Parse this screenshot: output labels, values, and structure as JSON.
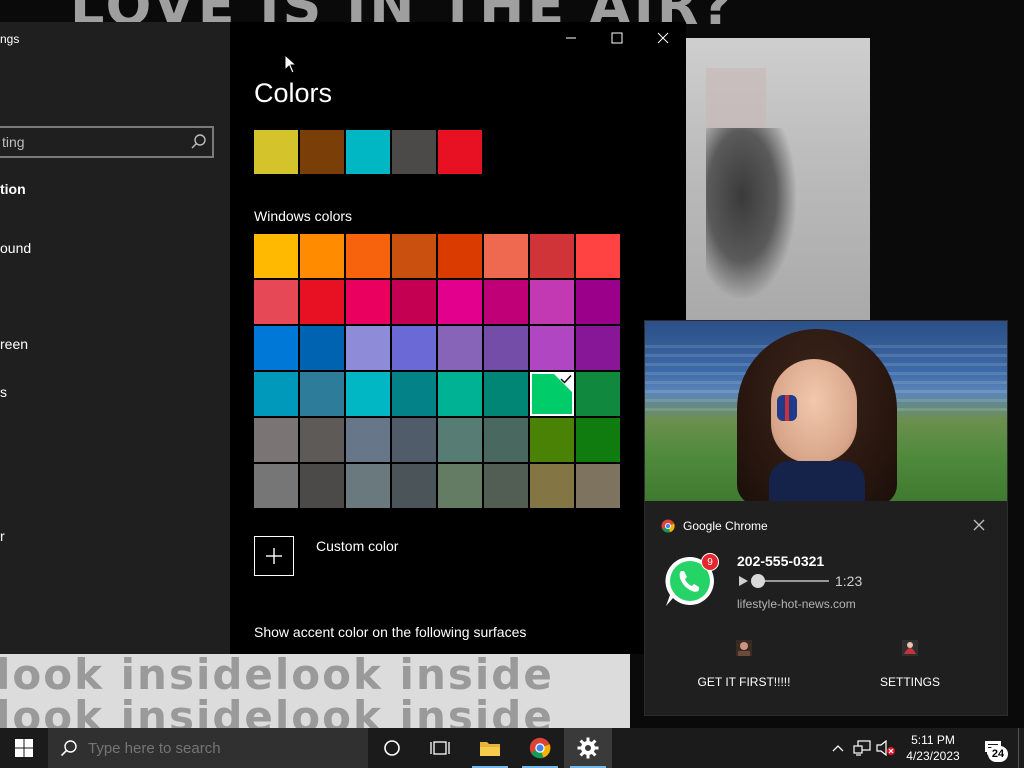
{
  "background": {
    "headline": "LOVE IS IN THE AIR?",
    "banner_line": "look insidelook inside"
  },
  "settings": {
    "app_title": "ngs",
    "search_value": "ting",
    "nav": [
      {
        "label": "tion",
        "active": true
      },
      {
        "label": "ound"
      },
      {
        "label": "reen"
      },
      {
        "label": "s"
      },
      {
        "label": "r"
      }
    ],
    "page_title": "Colors",
    "recent_colors": [
      "#d4c32a",
      "#7a3e08",
      "#00b7c3",
      "#4b4a48",
      "#e81123"
    ],
    "windows_colors_label": "Windows colors",
    "windows_colors": [
      "#ffb900",
      "#ff8c00",
      "#f7630c",
      "#ca5010",
      "#da3b01",
      "#ef6950",
      "#d13438",
      "#ff4343",
      "#e74856",
      "#e81123",
      "#ea005e",
      "#c30052",
      "#e3008c",
      "#bf0077",
      "#c239b3",
      "#9a0089",
      "#0078d7",
      "#0063b1",
      "#8e8cd8",
      "#6b69d6",
      "#8764b8",
      "#744da9",
      "#b146c2",
      "#881798",
      "#0099bc",
      "#2d7d9a",
      "#00b7c3",
      "#038387",
      "#00b294",
      "#018574",
      "#00cc6a",
      "#10893e",
      "#7a7574",
      "#5d5a58",
      "#68768a",
      "#515c6b",
      "#567c73",
      "#486860",
      "#498205",
      "#107c10",
      "#767676",
      "#4c4a48",
      "#69797e",
      "#4a5459",
      "#647c64",
      "#525e54",
      "#847545",
      "#7e735f"
    ],
    "selected_index": 30,
    "custom_color_label": "Custom color",
    "accent_surfaces_label": "Show accent color on the following surfaces"
  },
  "toast": {
    "app_name": "Google Chrome",
    "badge_count": "9",
    "caller": "202-555-0321",
    "duration": "1:23",
    "source": "lifestyle-hot-news.com",
    "action_primary": "GET IT FIRST!!!!!",
    "action_secondary": "SETTINGS"
  },
  "taskbar": {
    "search_placeholder": "Type here to search",
    "time": "5:11 PM",
    "date": "4/23/2023",
    "notification_count": "24"
  },
  "colors": {
    "taskbar_bg": "#1b1b1b",
    "settings_nav_bg": "#1f1f1f",
    "chrome_accent": "#76b9ed",
    "whatsapp_green": "#25d366"
  }
}
